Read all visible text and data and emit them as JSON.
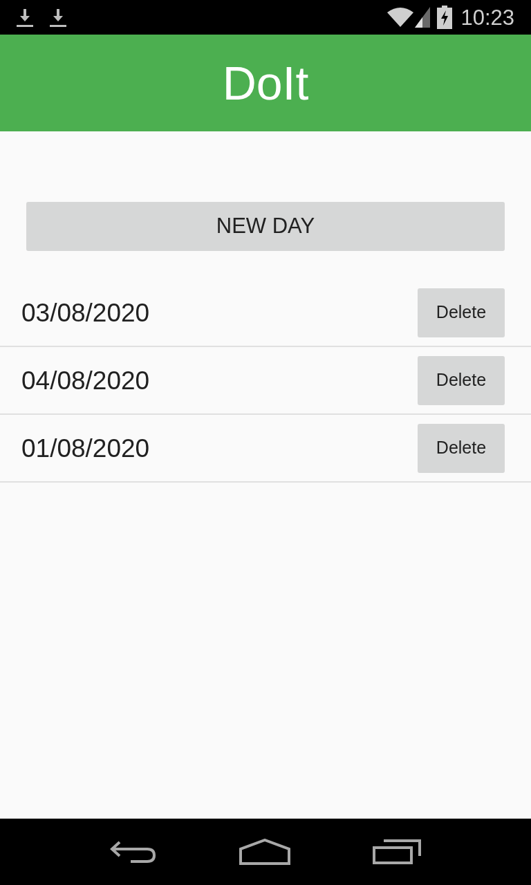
{
  "status_bar": {
    "time": "10:23"
  },
  "app_bar": {
    "title": "DoIt"
  },
  "new_day_button": {
    "label": "NEW DAY"
  },
  "days": [
    {
      "date": "03/08/2020",
      "action": "Delete"
    },
    {
      "date": "04/08/2020",
      "action": "Delete"
    },
    {
      "date": "01/08/2020",
      "action": "Delete"
    }
  ]
}
